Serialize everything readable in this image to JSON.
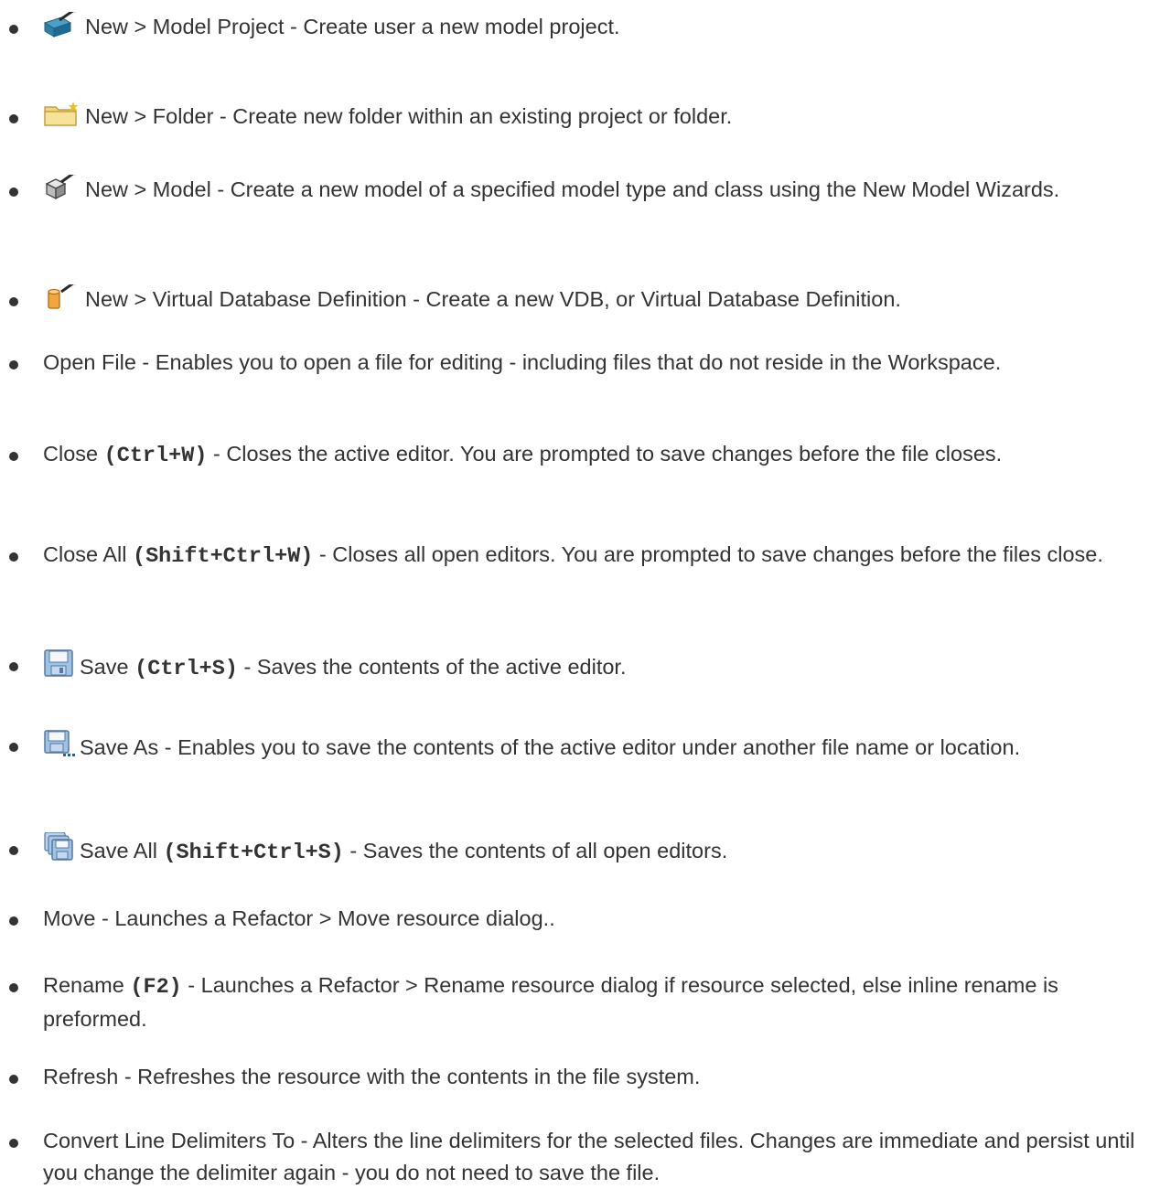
{
  "items": [
    {
      "icon": "new-project-icon",
      "name": "New > Model Project",
      "shortcut": "",
      "desc": " - Create user a new model project."
    },
    {
      "icon": "new-folder-icon",
      "name": "New > Folder",
      "shortcut": "",
      "desc": " - Create new folder within an existing project or folder."
    },
    {
      "icon": "new-model-icon",
      "name": "New > Model",
      "shortcut": "",
      "desc": " - Create a new model of a specified model type and class using the New Model Wizards."
    },
    {
      "icon": "new-vdb-icon",
      "name": "New > Virtual Database Definition",
      "shortcut": "",
      "desc": " - Create a new VDB, or Virtual Database Definition."
    },
    {
      "icon": "",
      "name": "Open File",
      "shortcut": "",
      "desc": " - Enables you to open a file for editing - including files that do not reside in the Workspace."
    },
    {
      "icon": "",
      "name": "Close",
      "shortcut": "(Ctrl+W)",
      "desc": " - Closes the active editor. You are prompted to save changes before the file closes."
    },
    {
      "icon": "",
      "name": "Close All",
      "shortcut": "(Shift+Ctrl+W)",
      "desc": " - Closes all open editors. You are prompted to save changes before the files close."
    },
    {
      "icon": "save-icon",
      "name": "Save",
      "shortcut": "(Ctrl+S)",
      "desc": " - Saves the contents of the active editor."
    },
    {
      "icon": "save-as-icon",
      "name": "Save As",
      "shortcut": "",
      "desc": " - Enables you to save the contents of the active editor under another file name or location."
    },
    {
      "icon": "save-all-icon",
      "name": "Save All",
      "shortcut": "(Shift+Ctrl+S)",
      "desc": " - Saves the contents of all open editors."
    },
    {
      "icon": "",
      "name": "Move",
      "shortcut": "",
      "desc": " - Launches a Refactor > Move resource dialog.."
    },
    {
      "icon": "",
      "name": "Rename",
      "shortcut": "(F2)",
      "desc": " - Launches a Refactor > Rename resource dialog if resource selected, else inline rename is preformed."
    },
    {
      "icon": "",
      "name": "Refresh",
      "shortcut": "",
      "desc": " - Refreshes the resource with the contents in the file system."
    },
    {
      "icon": "",
      "name": "Convert Line Delimiters To",
      "shortcut": "",
      "desc": " - Alters the line delimiters for the selected files. Changes are immediate and persist until you change the delimiter again - you do not need to save the file."
    }
  ]
}
